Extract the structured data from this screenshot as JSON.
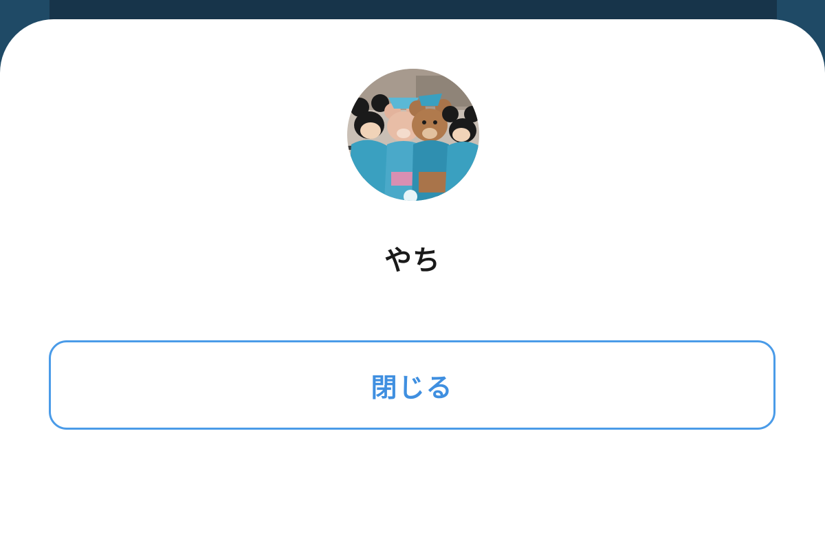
{
  "profile_sheet": {
    "display_name": "やち",
    "avatar": {
      "icon": "character-plush-photo",
      "description_colors": {
        "sky": "#b8a89a",
        "teal_costume": "#3aa0c0",
        "bear_fur": "#a9744a",
        "pink_bear": "#e3b39c",
        "black": "#1a1a1a"
      }
    },
    "close_button_label": "閉じる"
  },
  "colors": {
    "backdrop": "#1f4a66",
    "backdrop_panel": "#17344a",
    "sheet_bg": "#ffffff",
    "accent": "#4a9be8",
    "name_text": "#1a1a1a"
  }
}
